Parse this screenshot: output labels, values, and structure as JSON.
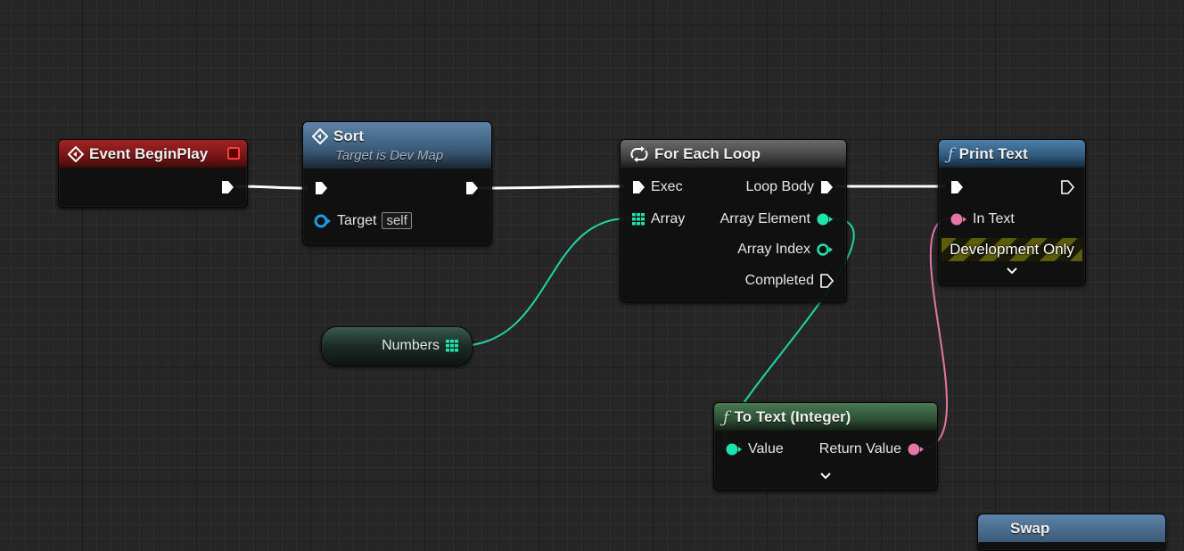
{
  "nodes": {
    "event_begin_play": {
      "title": "Event BeginPlay",
      "icon": "event-icon",
      "color": "#8c1b1b"
    },
    "sort": {
      "title": "Sort",
      "subtitle": "Target is Dev Map",
      "icon": "function-call-icon",
      "color": "#4d6f8f",
      "target_label": "Target",
      "target_value": "self"
    },
    "for_each_loop": {
      "title": "For Each Loop",
      "icon": "loop-icon",
      "color": "#555555",
      "exec_label": "Exec",
      "array_label": "Array",
      "loop_body_label": "Loop Body",
      "array_element_label": "Array Element",
      "array_index_label": "Array Index",
      "completed_label": "Completed"
    },
    "print_text": {
      "title": "Print Text",
      "icon": "function-icon",
      "color": "#3f6c93",
      "in_text_label": "In Text",
      "dev_only_label": "Development Only"
    },
    "numbers": {
      "label": "Numbers",
      "icon": "array-grid-icon"
    },
    "to_text_integer": {
      "title": "To Text (Integer)",
      "icon": "function-icon",
      "color": "#3e6d45",
      "value_label": "Value",
      "return_value_label": "Return Value"
    },
    "partial_node": {
      "title": "Swap"
    }
  },
  "colors": {
    "exec": "#ffffff",
    "integer": "#1fe3af",
    "text": "#e376a6",
    "object": "#1a9ae8"
  }
}
